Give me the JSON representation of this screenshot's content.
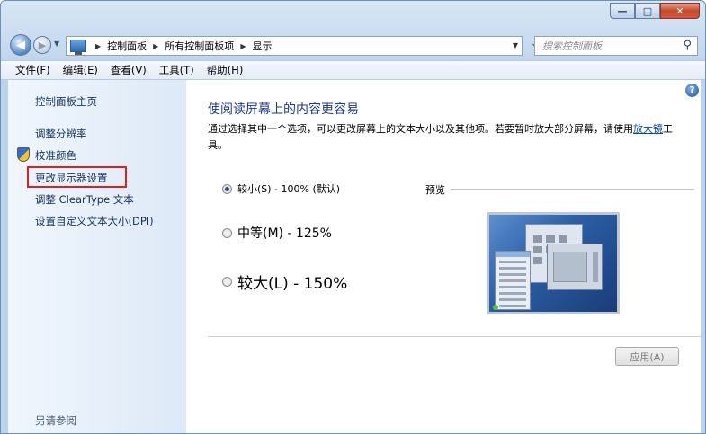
{
  "window": {
    "minimize": "—",
    "maximize": "□",
    "close": "✕"
  },
  "nav": {
    "breadcrumbs": [
      "控制面板",
      "所有控制面板项",
      "显示"
    ],
    "search_placeholder": "搜索控制面板"
  },
  "menu": [
    "文件(F)",
    "编辑(E)",
    "查看(V)",
    "工具(T)",
    "帮助(H)"
  ],
  "sidebar": {
    "home": "控制面板主页",
    "resolution": "调整分辨率",
    "calibrate": "校准颜色",
    "display_settings": "更改显示器设置",
    "cleartype": "调整 ClearType 文本",
    "custom_dpi": "设置自定义文本大小(DPI)",
    "see_also": "另请参阅"
  },
  "main": {
    "title": "使阅读屏幕上的内容更容易",
    "desc_before": "通过选择其中一个选项，可以更改屏幕上的文本大小以及其他项。若要暂时放大部分屏幕，请使用",
    "desc_link": "放大镜",
    "desc_after": "工具。",
    "options": {
      "small": "较小(S) - 100% (默认)",
      "medium": "中等(M) - 125%",
      "large": "较大(L) - 150%"
    },
    "selected_option": "small",
    "preview_label": "预览",
    "apply": "应用(A)"
  }
}
